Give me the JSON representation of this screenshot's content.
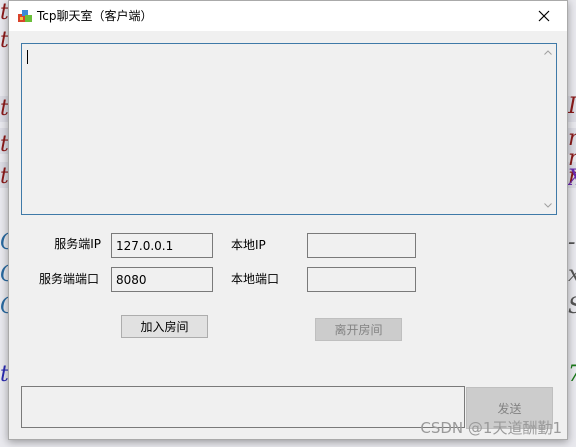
{
  "window": {
    "title": "Tcp聊天室（客户端）",
    "close_glyph": "✕"
  },
  "messages": {
    "content": ""
  },
  "server": {
    "ip_label": "服务端IP",
    "ip_value": "127.0.0.1",
    "port_label": "服务端端口",
    "port_value": "8080"
  },
  "local": {
    "ip_label": "本地IP",
    "ip_value": "",
    "port_label": "本地端口",
    "port_value": ""
  },
  "buttons": {
    "join_label": "加入房间",
    "leave_label": "离开房间",
    "send_label": "发送"
  },
  "send": {
    "value": ""
  },
  "watermark": "CSDN @1天道酬勤1",
  "background": {
    "left_glyphs": [
      "t",
      "t",
      "t",
      "t",
      "t",
      "C",
      "C",
      "C",
      "t"
    ],
    "right_glyphs": [
      "I",
      "r",
      "r",
      "r",
      "X",
      "-",
      "x",
      "S",
      "7"
    ]
  },
  "colors": {
    "window_bg": "#f0f0f0",
    "titlebar_bg": "#ffffff",
    "focus_border": "#3f7aa8",
    "disabled_text": "#838383"
  }
}
